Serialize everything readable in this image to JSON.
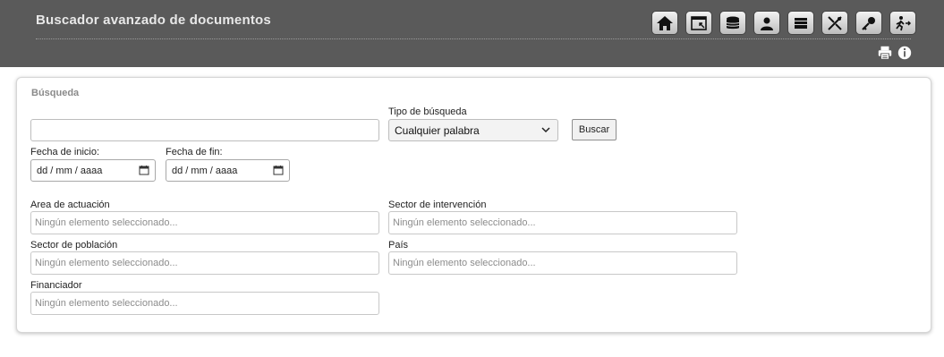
{
  "header": {
    "title": "Buscador avanzado de documentos",
    "toolbar": [
      {
        "icon": "home-icon"
      },
      {
        "icon": "window-icon"
      },
      {
        "icon": "database-icon"
      },
      {
        "icon": "user-icon"
      },
      {
        "icon": "books-icon"
      },
      {
        "icon": "tools-icon"
      },
      {
        "icon": "key-icon"
      },
      {
        "icon": "exit-icon"
      }
    ],
    "utilities": [
      {
        "icon": "print-icon"
      },
      {
        "icon": "info-icon"
      }
    ]
  },
  "search": {
    "section_label": "Búsqueda",
    "query_value": "",
    "type_label": "Tipo de búsqueda",
    "type_selected": "Cualquier palabra",
    "submit_label": "Buscar",
    "start_date_label": "Fecha de inicio:",
    "start_date_value": "dd / mm / aaaa",
    "end_date_label": "Fecha de fin:",
    "end_date_value": "dd / mm / aaaa"
  },
  "filters": {
    "area_label": "Area de actuación",
    "area_value": "Ningún elemento seleccionado...",
    "sector_intervencion_label": "Sector de intervención",
    "sector_intervencion_value": "Ningún elemento seleccionado...",
    "sector_poblacion_label": "Sector de población",
    "sector_poblacion_value": "Ningún elemento seleccionado...",
    "pais_label": "País",
    "pais_value": "Ningún elemento seleccionado...",
    "financiador_label": "Financiador",
    "financiador_value": "Ningún elemento seleccionado..."
  },
  "colors": {
    "header_bg": "#5a5a5a",
    "title_text": "#e8e8e8",
    "placeholder_text": "#8c8c8c"
  }
}
